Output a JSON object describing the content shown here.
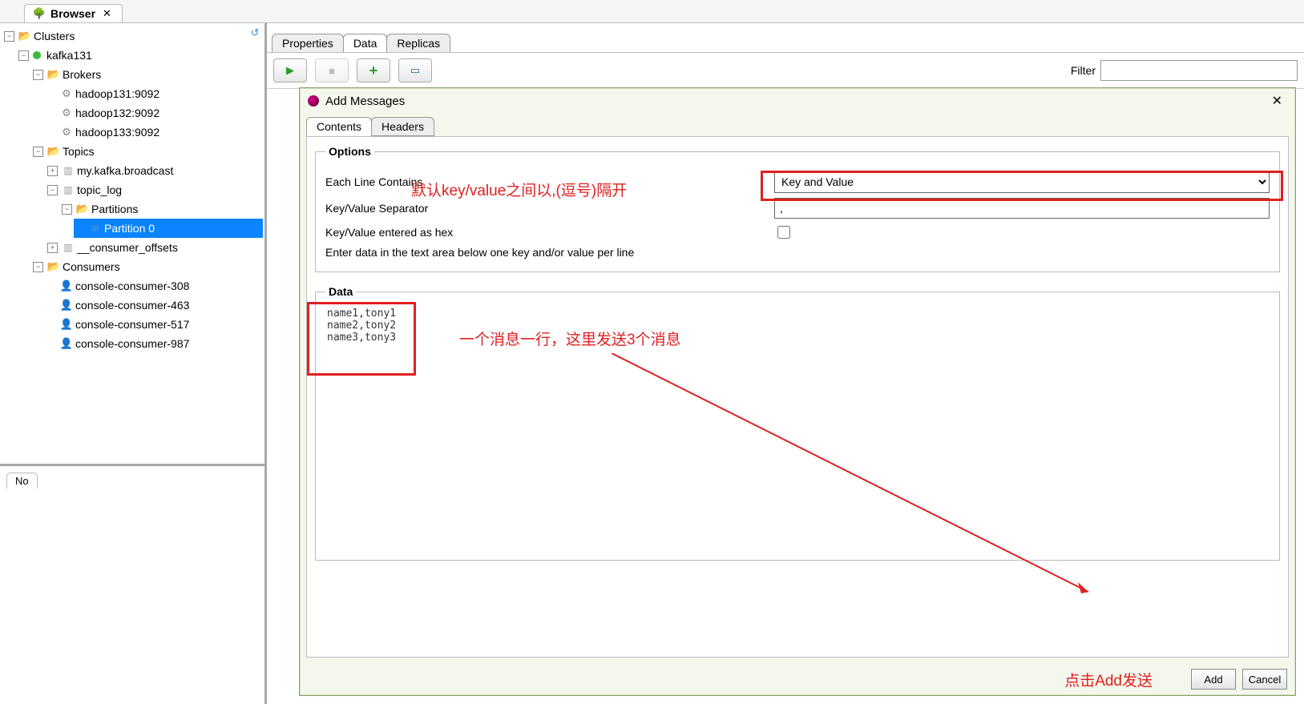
{
  "topTab": {
    "title": "Browser"
  },
  "tree": {
    "root": "Clusters",
    "cluster": "kafka131",
    "brokers": {
      "label": "Brokers",
      "items": [
        "hadoop131:9092",
        "hadoop132:9092",
        "hadoop133:9092"
      ]
    },
    "topics": {
      "label": "Topics",
      "items": [
        "my.kafka.broadcast",
        "topic_log",
        "__consumer_offsets"
      ],
      "partitionsLabel": "Partitions",
      "partition0": "Partition 0"
    },
    "consumers": {
      "label": "Consumers",
      "items": [
        "console-consumer-308",
        "console-consumer-463",
        "console-consumer-517",
        "console-consumer-987"
      ]
    }
  },
  "noDetail": {
    "label": "No"
  },
  "viewTabs": [
    "Properties",
    "Data",
    "Replicas"
  ],
  "toolbar": {
    "filterLabel": "Filter"
  },
  "dialog": {
    "title": "Add Messages",
    "tabs": [
      "Contents",
      "Headers"
    ],
    "options": {
      "legend": "Options",
      "eachLine": "Each Line Contains",
      "eachLineValue": "Key and Value",
      "sepLabel": "Key/Value Separator",
      "sepValue": ",",
      "hexLabel": "Key/Value entered as hex",
      "hint": "Enter data in the text area below one key and/or value per line"
    },
    "data": {
      "legend": "Data",
      "value": "name1,tony1\nname2,tony2\nname3,tony3"
    },
    "buttons": {
      "add": "Add",
      "cancel": "Cancel"
    }
  },
  "annotations": {
    "sep": "默认key/value之间以,(逗号)隔开",
    "line": "一个消息一行，这里发送3个消息",
    "add": "点击Add发送"
  }
}
